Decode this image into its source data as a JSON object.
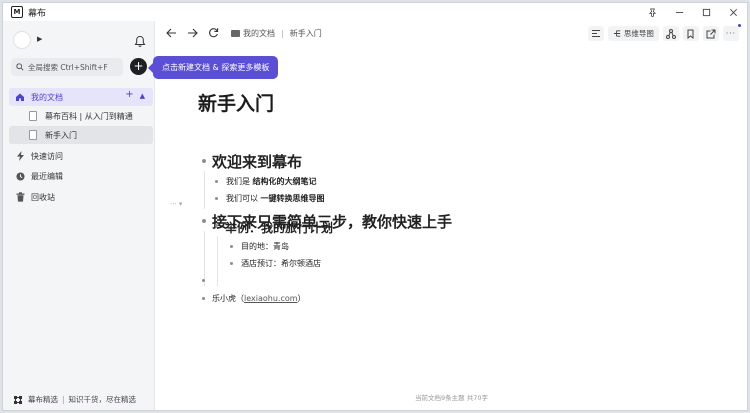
{
  "window": {
    "title": "幕布",
    "controls": [
      "pin-icon",
      "minimize-icon",
      "maximize-icon",
      "close-icon"
    ]
  },
  "sidebar": {
    "search_placeholder": "全局搜索 Ctrl+Shift+F",
    "tooltip": "点击新建文档 & 探索更多模板",
    "my_docs": "我的文档",
    "docs": [
      "幕布百科 | 从入门到精通",
      "新手入门"
    ],
    "items": [
      {
        "label": "快速访问",
        "icon": "lightning-icon"
      },
      {
        "label": "最近编辑",
        "icon": "clock-icon"
      },
      {
        "label": "回收站",
        "icon": "trash-icon"
      }
    ],
    "footer": {
      "brand": "幕布精选",
      "slogan": "知识千货，尽在精选"
    }
  },
  "breadcrumb": {
    "root": "我的文档",
    "current": "新手入门"
  },
  "toolbar": {
    "mindmap_label": "思维导图"
  },
  "document": {
    "title": "新手入门",
    "s1": {
      "heading": "欢迎来到幕布",
      "i1_prefix": "我们是",
      "i1_bold": "结构化的大纲笔记",
      "i2_prefix": "我们可以",
      "i2_bold": "一键转换思维导图"
    },
    "s2": {
      "heading": "接下来只需简单三步，教你快速上手",
      "sub_heading": "举例：我的旅行计划",
      "items": [
        "目的地：青岛",
        "酒店预订：希尔顿酒店"
      ]
    },
    "author": {
      "name": "乐小虎",
      "open": "（",
      "link": "lexiaohu.com",
      "close": "）"
    },
    "stats": "当前文档9条主题 共70字"
  },
  "colors": {
    "accent": "#5b4fd6",
    "selected_bg": "#e6e4fb"
  }
}
